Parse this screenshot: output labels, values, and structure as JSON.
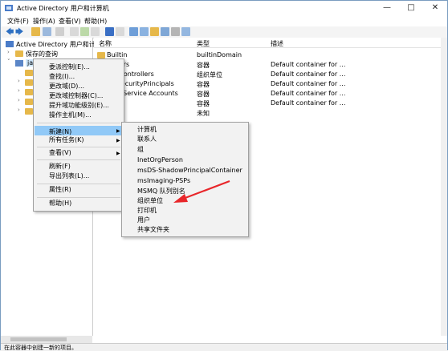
{
  "window": {
    "title": "Active Directory 用户和计算机"
  },
  "menubar": [
    "文件(F)",
    "操作(A)",
    "查看(V)",
    "帮助(H)"
  ],
  "tree": {
    "root": "Active Directory 用户和计算机",
    "saved_queries": "保存的查询",
    "domain": "jain.l"
  },
  "list": {
    "columns": [
      "名称",
      "类型",
      "描述"
    ],
    "rows": [
      {
        "name": "Builtin",
        "type": "builtinDomain",
        "desc": ""
      },
      {
        "name": "...uters",
        "type": "容器",
        "desc": "Default container for ..."
      },
      {
        "name": "...n Controllers",
        "type": "组织单位",
        "desc": "Default container for ..."
      },
      {
        "name": "...nSecurityPrincipals",
        "type": "容器",
        "desc": "Default container for ..."
      },
      {
        "name": "...ed Service Accounts",
        "type": "容器",
        "desc": "Default container for ..."
      },
      {
        "name": "",
        "type": "容器",
        "desc": "Default container for ..."
      },
      {
        "name": "",
        "type": "未知",
        "desc": ""
      }
    ]
  },
  "context_menu": {
    "items": [
      "委派控制(E)...",
      "查找(I)...",
      "更改域(D)...",
      "更改域控制器(C)...",
      "提升域功能级别(E)...",
      "操作主机(M)..."
    ],
    "new": "新建(N)",
    "all_tasks": "所有任务(K)",
    "view": "查看(V)",
    "refresh": "刷新(F)",
    "export": "导出列表(L)...",
    "properties": "属性(R)",
    "help": "帮助(H)"
  },
  "submenu": {
    "items": [
      "计算机",
      "联系人",
      "组",
      "InetOrgPerson",
      "msDS-ShadowPrincipalContainer",
      "msImaging-PSPs",
      "MSMQ 队列别名",
      "组织单位",
      "打印机",
      "用户",
      "共享文件夹"
    ]
  },
  "status": "在此容器中创建一新的项目。",
  "colors": {
    "highlight": "#91c9f7",
    "annotation_arrow": "#e8262a",
    "folder": "#e6b84a"
  }
}
